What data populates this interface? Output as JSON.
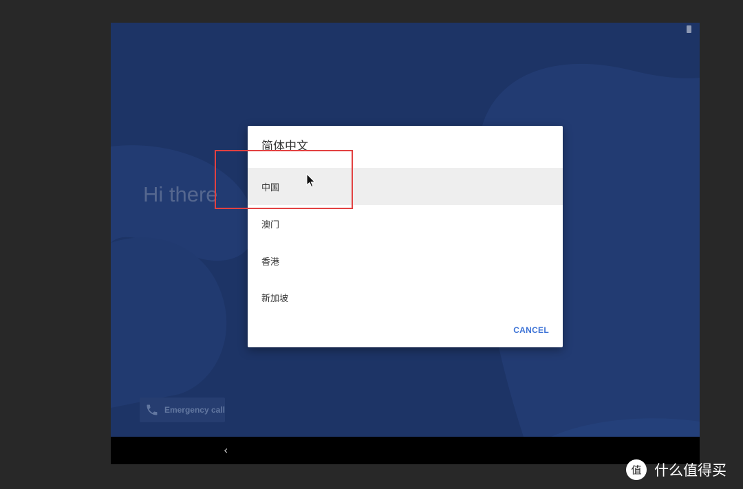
{
  "screen": {
    "greeting": "Hi there",
    "emergency_label": "Emergency call",
    "nav_back_glyph": "‹",
    "colors": {
      "background": "#1d3466",
      "dialog": "#ffffff",
      "accent": "#3d73d6",
      "highlight": "#e24141"
    }
  },
  "dialog": {
    "title": "简体中文",
    "options": [
      {
        "label": "中国",
        "selected": true
      },
      {
        "label": "澳门",
        "selected": false
      },
      {
        "label": "香港",
        "selected": false
      },
      {
        "label": "新加坡",
        "selected": false
      }
    ],
    "cancel_label": "CANCEL"
  },
  "watermark": {
    "text": "什么值得买",
    "logo_glyph": "值"
  },
  "icons": {
    "phone": "phone-icon",
    "battery": "battery-icon",
    "back": "back-icon",
    "cursor": "mouse-cursor-icon"
  }
}
